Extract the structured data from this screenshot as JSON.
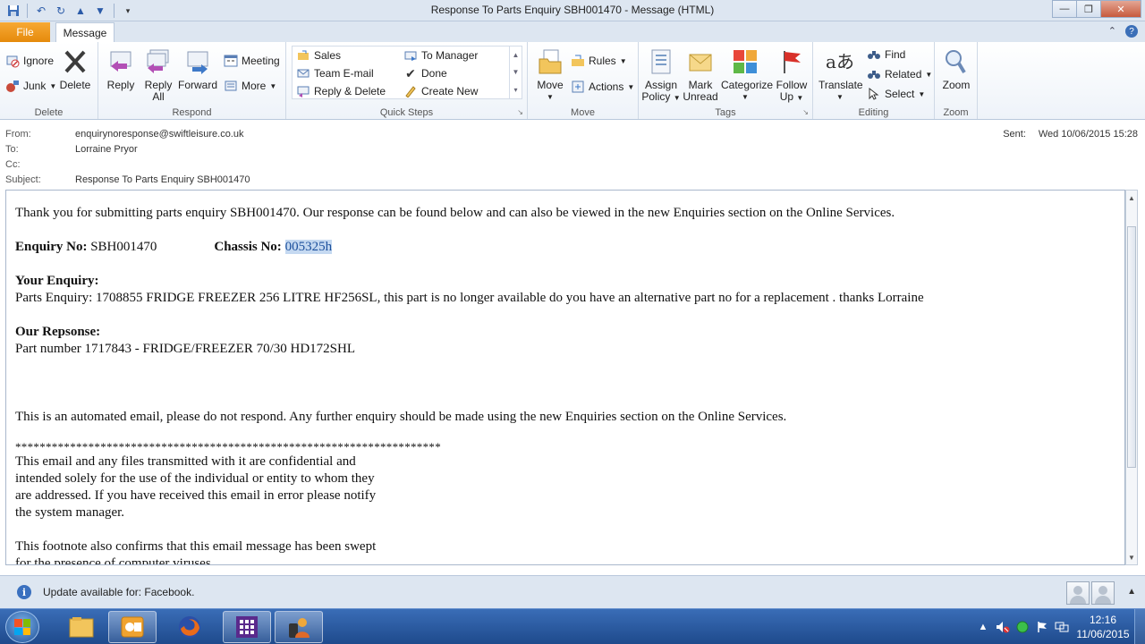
{
  "window": {
    "title": "Response To Parts Enquiry SBH001470  -  Message (HTML)",
    "minimize": "—",
    "restore": "❐",
    "close": "✕"
  },
  "tabs": {
    "file": "File",
    "message": "Message"
  },
  "ribbon": {
    "delete_group": {
      "label": "Delete",
      "ignore": "Ignore",
      "junk": "Junk",
      "delete": "Delete"
    },
    "respond_group": {
      "label": "Respond",
      "reply": "Reply",
      "reply_all_1": "Reply",
      "reply_all_2": "All",
      "forward": "Forward",
      "meeting": "Meeting",
      "more": "More"
    },
    "quick_steps": {
      "label": "Quick Steps",
      "items": [
        "Sales",
        "To Manager",
        "Team E-mail",
        "Done",
        "Reply & Delete",
        "Create New"
      ]
    },
    "move_group": {
      "label": "Move",
      "move": "Move",
      "rules": "Rules",
      "actions": "Actions"
    },
    "tags_group": {
      "label": "Tags",
      "assign_1": "Assign",
      "assign_2": "Policy",
      "mark_1": "Mark",
      "mark_2": "Unread",
      "categorize": "Categorize",
      "follow_1": "Follow",
      "follow_2": "Up"
    },
    "editing_group": {
      "label": "Editing",
      "translate": "Translate",
      "find": "Find",
      "related": "Related",
      "select": "Select"
    },
    "zoom_group": {
      "label": "Zoom",
      "zoom": "Zoom"
    }
  },
  "header": {
    "from_label": "From:",
    "from": "enquirynoresponse@swiftleisure.co.uk",
    "to_label": "To:",
    "to": "Lorraine Pryor",
    "cc_label": "Cc:",
    "cc": "",
    "subject_label": "Subject:",
    "subject": "Response To Parts Enquiry SBH001470",
    "sent_label": "Sent:",
    "sent": "Wed 10/06/2015 15:28"
  },
  "body": {
    "intro": "Thank you for submitting parts enquiry SBH001470. Our response can be found below and can also be viewed in the new Enquiries section on the Online Services.",
    "enquiry_no_label": "Enquiry No:",
    "enquiry_no": "SBH001470",
    "chassis_no_label": "Chassis No:",
    "chassis_no": "005325h",
    "your_enquiry_label": "Your Enquiry:",
    "your_enquiry": "Parts Enquiry: 1708855 FRIDGE FREEZER 256 LITRE HF256SL, this part is no longer available do you have an alternative part no for a replacement . thanks Lorraine",
    "our_response_label": "Our Repsonse:",
    "our_response": "Part number 1717843 - FRIDGE/FREEZER 70/30 HD172SHL",
    "automated": "This is an automated email, please do not respond. Any further enquiry should be made using the new Enquiries section on the Online Services.",
    "stars": "**********************************************************************",
    "disclaimer_1": "This email and any files transmitted with it are confidential and",
    "disclaimer_2": "intended solely for the use of the individual or entity to whom they",
    "disclaimer_3": "are addressed. If you have received this email in error please notify",
    "disclaimer_4": "the system manager.",
    "footnote_1": "This footnote also confirms that this email message has been swept",
    "footnote_2": "for the presence of computer viruses."
  },
  "infobar": {
    "text": "Update available for: Facebook."
  },
  "taskbar": {
    "time": "12:16",
    "date": "11/06/2015"
  }
}
